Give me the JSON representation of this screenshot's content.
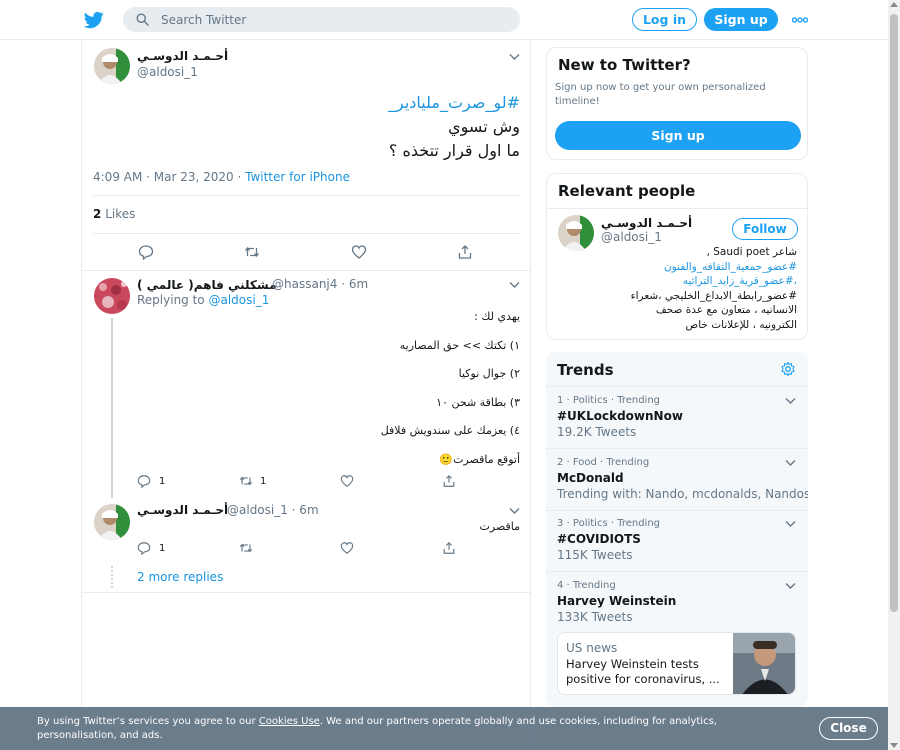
{
  "header": {
    "search_placeholder": "Search Twitter",
    "login_label": "Log in",
    "signup_label": "Sign up",
    "brand_color": "#1da1f2"
  },
  "main_tweet": {
    "author_name": "أحـمـد الدوسـي",
    "author_handle": "@aldosi_1",
    "hashtag": "#لو_صرت_مليادير_",
    "line2": "وش تسوي",
    "line3": "ما اول قرار تتخذه ؟",
    "time": "4:09 AM · Mar 23, 2020 · ",
    "source": "Twitter for iPhone",
    "likes_count": "2",
    "likes_label": "Likes"
  },
  "reply1": {
    "author_name": "مشكلني فاهم( عالمي )",
    "author_handle": "@hassanj4 · 6m",
    "replying_label": "Replying to ",
    "replying_handle": "@aldosi_1",
    "lines": [
      "يهدي لك :",
      "١) تكتك >> حق المصاريه",
      "٢) جوال نوكيا",
      "٣) بطاقة شحن ١٠",
      "٤) يعزمك على سندويش فلافل",
      "أتوقع ماقصرت🙂"
    ],
    "reply_count": "1",
    "retweet_count": "1"
  },
  "reply2": {
    "author_name": "أحـمـد الدوسـي",
    "author_handle": "@aldosi_1 · 6m",
    "text": "ماقصرت",
    "reply_count": "1"
  },
  "more_replies": "2 more replies",
  "new_to_twitter": {
    "title": "New to Twitter?",
    "subtitle": "Sign up now to get your own personalized timeline!",
    "button": "Sign up"
  },
  "relevant_people": {
    "title": "Relevant people",
    "name": "أحـمـد الدوسـي",
    "handle": "@aldosi_1",
    "follow": "Follow",
    "bio_lines": [
      "شاعر Saudi poet ,",
      "#عضو_جمعية_الثقافه_والفنون",
      "،#عضو_قرية_زايد_التراثيه",
      "#عضو_رابطة_الابداع_الخليجي ،شعراء",
      "الانسانيه ، متعاون مع عدة صحف",
      "الكترونيه ، للإعلانات خاص"
    ]
  },
  "trends": {
    "title": "Trends",
    "items": [
      {
        "meta": "1 · Politics · Trending",
        "name": "#UKLockdownNow",
        "count": "19.2K Tweets"
      },
      {
        "meta": "2 · Food · Trending",
        "name": "McDonald",
        "count": "Trending with: Nando, mcdonalds, Nandos"
      },
      {
        "meta": "3 · Politics · Trending",
        "name": "#COVIDIOTS",
        "count": "115K Tweets"
      },
      {
        "meta": "4 · Trending",
        "name": "Harvey Weinstein",
        "count": "133K Tweets"
      }
    ],
    "news": {
      "source": "US news",
      "headline": "Harvey Weinstein tests positive for coronavirus, ..."
    }
  },
  "cookie": {
    "pre": "By using Twitter’s services you agree to our ",
    "link": "Cookies Use",
    "post": ". We and our partners operate globally and use cookies, including for analytics, personalisation, and ads.",
    "close": "Close"
  }
}
